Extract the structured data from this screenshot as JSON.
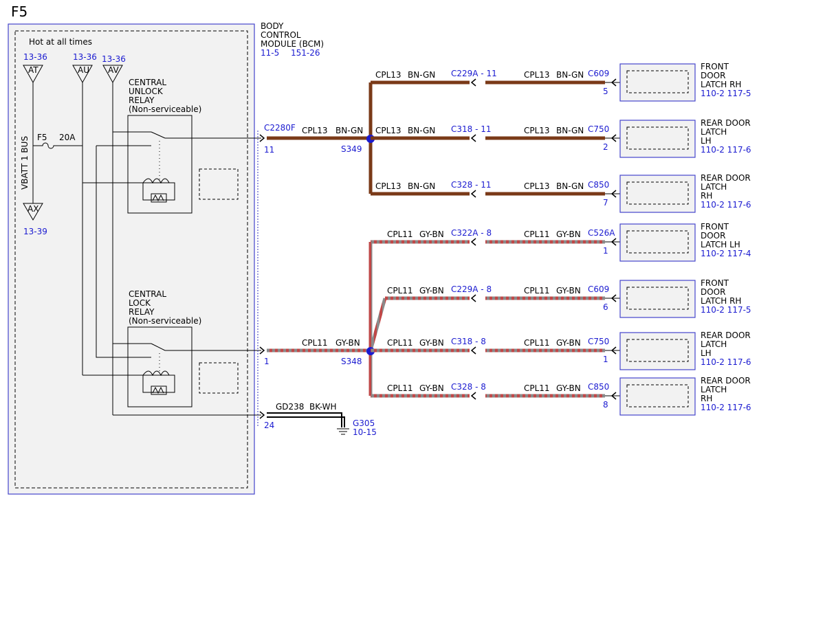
{
  "page": {
    "id": "F5"
  },
  "colors": {
    "link": "#1a1ad0",
    "wire_bn_gn": "#7a3a18",
    "wire_gy_bn": "#8a8a8a",
    "wire_stripe": "#c04848",
    "module_fill": "#f2f2f2",
    "module_border": "#4444cc"
  },
  "bcm": {
    "name_lines": [
      "BODY",
      "CONTROL",
      "MODULE (BCM)"
    ],
    "refs": [
      "11-5",
      "151-26"
    ],
    "hot_label": "Hot at all times",
    "bus_label": "VBATT 1 BUS",
    "fuse_name": "F5",
    "fuse_rating": "20A",
    "unlock_relay_lines": [
      "CENTRAL",
      "UNLOCK",
      "RELAY",
      "(Non-serviceable)"
    ],
    "lock_relay_lines": [
      "CENTRAL",
      "LOCK",
      "RELAY",
      "(Non-serviceable)"
    ],
    "power": [
      {
        "id": "AT",
        "ref": "13-36"
      },
      {
        "id": "AU",
        "ref": "13-36"
      },
      {
        "id": "AV",
        "ref": "13-36"
      }
    ],
    "bus_end": {
      "id": "AX",
      "ref": "13-39"
    },
    "outputs": [
      {
        "connector": "C2280F",
        "pin": "11"
      },
      {
        "pin": "1"
      },
      {
        "pin": "24"
      }
    ]
  },
  "splices": {
    "upper": "S349",
    "lower": "S348"
  },
  "ground": {
    "wire": "GD238",
    "color": "BK-WH",
    "name": "G305",
    "ref": "10-15"
  },
  "wires": {
    "unlock_main": {
      "circuit": "CPL13",
      "color": "BN-GN"
    },
    "lock_main": {
      "circuit": "CPL11",
      "color": "GY-BN"
    }
  },
  "branches": [
    {
      "circuit": "CPL13",
      "color": "BN-GN",
      "inline": "C229A",
      "inline_pin": "11",
      "connector": "C609",
      "pin": "5",
      "device": [
        "FRONT",
        "DOOR",
        "LATCH RH"
      ],
      "ref": "110-2 117-5"
    },
    {
      "circuit": "CPL13",
      "color": "BN-GN",
      "inline": "C318",
      "inline_pin": "11",
      "connector": "C750",
      "pin": "2",
      "device": [
        "REAR DOOR",
        "LATCH",
        "LH"
      ],
      "ref": "110-2 117-6"
    },
    {
      "circuit": "CPL13",
      "color": "BN-GN",
      "inline": "C328",
      "inline_pin": "11",
      "connector": "C850",
      "pin": "7",
      "device": [
        "REAR DOOR",
        "LATCH",
        "RH"
      ],
      "ref": "110-2 117-6"
    },
    {
      "circuit": "CPL11",
      "color": "GY-BN",
      "inline": "C322A",
      "inline_pin": "8",
      "connector": "C526A",
      "pin": "1",
      "device": [
        "FRONT",
        "DOOR",
        "LATCH LH"
      ],
      "ref": "110-2 117-4"
    },
    {
      "circuit": "CPL11",
      "color": "GY-BN",
      "inline": "C229A",
      "inline_pin": "8",
      "connector": "C609",
      "pin": "6",
      "device": [
        "FRONT",
        "DOOR",
        "LATCH RH"
      ],
      "ref": "110-2 117-5"
    },
    {
      "circuit": "CPL11",
      "color": "GY-BN",
      "inline": "C318",
      "inline_pin": "8",
      "connector": "C750",
      "pin": "1",
      "device": [
        "REAR DOOR",
        "LATCH",
        "LH"
      ],
      "ref": "110-2 117-6"
    },
    {
      "circuit": "CPL11",
      "color": "GY-BN",
      "inline": "C328",
      "inline_pin": "8",
      "connector": "C850",
      "pin": "8",
      "device": [
        "REAR DOOR",
        "LATCH",
        "RH"
      ],
      "ref": "110-2 117-6"
    }
  ]
}
